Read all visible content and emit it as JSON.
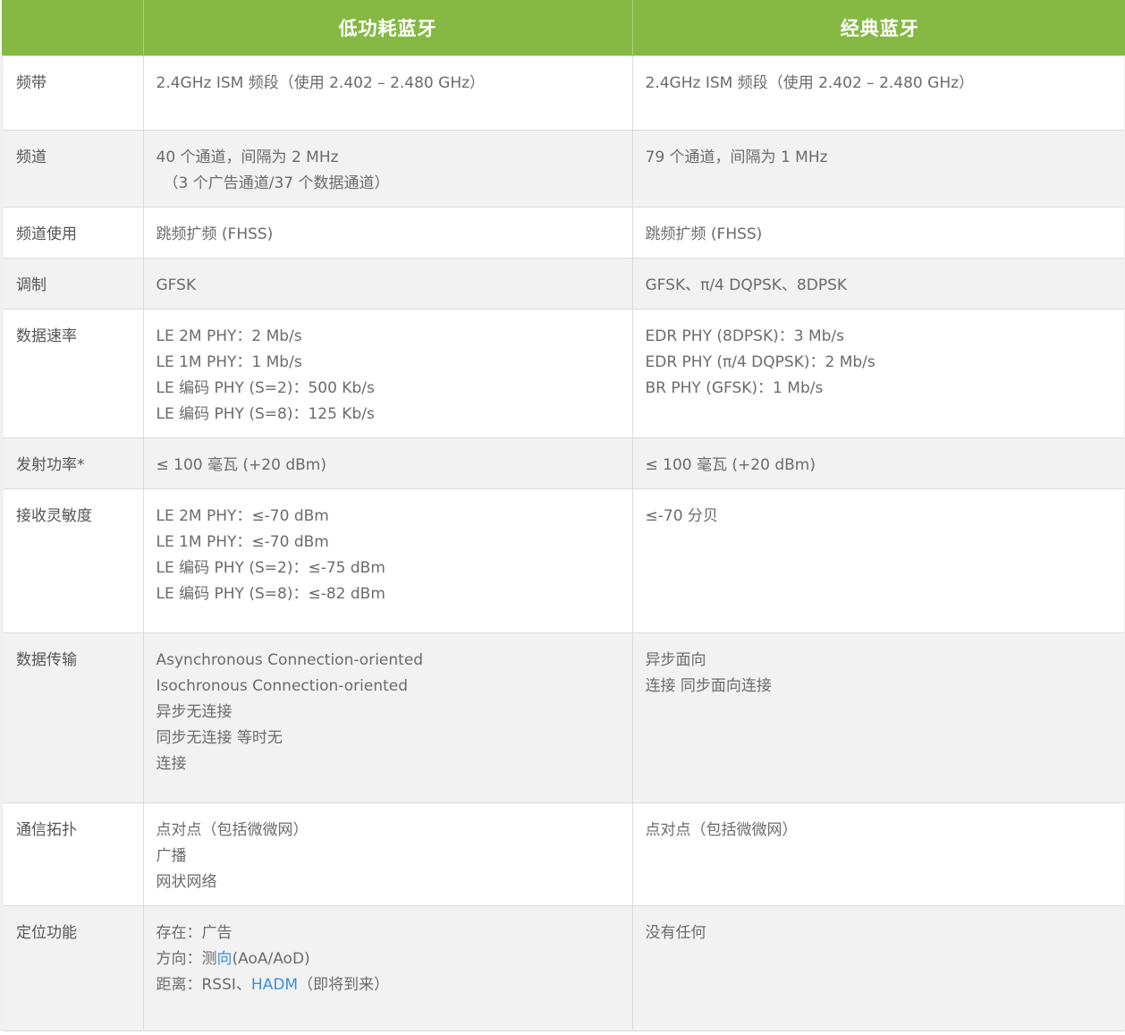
{
  "header": {
    "col1": "",
    "col2": "低功耗蓝牙",
    "col3": "经典蓝牙"
  },
  "colors": {
    "header_bg": "#85b944",
    "header_text": "#ffffff",
    "zebra": "#f2f2f2",
    "link": "#3b8fd6"
  },
  "rows": {
    "band": {
      "label": "频带",
      "le": [
        "2.4GHz ISM 频段（使用 2.402 – 2.480 GHz）"
      ],
      "classic": [
        "2.4GHz ISM 频段（使用 2.402 – 2.480 GHz）"
      ]
    },
    "channels": {
      "label": "频道",
      "le": [
        "40 个通道，间隔为 2 MHz",
        "（3 个广告通道/37 个数据通道）"
      ],
      "classic": [
        "79 个通道，间隔为 1 MHz"
      ]
    },
    "channel_usage": {
      "label": "频道使用",
      "le": [
        "跳频扩频 (FHSS)"
      ],
      "classic": [
        "跳频扩频 (FHSS)"
      ]
    },
    "modulation": {
      "label": "调制",
      "le": [
        "GFSK"
      ],
      "classic": [
        "GFSK、π/4 DQPSK、8DPSK"
      ]
    },
    "data_rate": {
      "label": "数据速率",
      "le": [
        "LE 2M PHY：2 Mb/s",
        "LE 1M PHY：1 Mb/s",
        "LE 编码 PHY (S=2)：500 Kb/s",
        "LE 编码 PHY (S=8)：125 Kb/s"
      ],
      "classic": [
        "EDR PHY (8DPSK)：3 Mb/s",
        "EDR PHY (π/4 DQPSK)：2 Mb/s",
        "BR PHY (GFSK)：1 Mb/s"
      ]
    },
    "tx_power": {
      "label": "发射功率*",
      "le": [
        "≤ 100 毫瓦 (+20 dBm)"
      ],
      "classic": [
        "≤ 100 毫瓦 (+20 dBm)"
      ]
    },
    "rx_sensitivity": {
      "label": "接收灵敏度",
      "le": [
        "LE 2M PHY：≤-70 dBm",
        "LE 1M PHY：≤-70 dBm",
        "LE 编码 PHY (S=2)：≤-75 dBm",
        "LE 编码 PHY (S=8)：≤-82 dBm"
      ],
      "classic": [
        "≤-70 分贝"
      ]
    },
    "data_transfer": {
      "label": "数据传输",
      "le": [
        "Asynchronous Connection-oriented",
        "Isochronous Connection-oriented",
        "异步无连接",
        "同步无连接 等时无",
        "连接"
      ],
      "classic": [
        "异步面向",
        "连接 同步面向连接"
      ]
    },
    "topology": {
      "label": "通信拓扑",
      "le": [
        "点对点（包括微微网）",
        "广播",
        "网状网络"
      ],
      "classic": [
        "点对点（包括微微网）"
      ]
    },
    "positioning": {
      "label": "定位功能",
      "le_presence": "存在：广告",
      "le_direction_prefix": "方向：测",
      "le_direction_link": "向",
      "le_direction_suffix": "(AoA/AoD)",
      "le_distance_prefix": "距离：RSSI、",
      "le_distance_link": "HADM",
      "le_distance_suffix": "（即将到来）",
      "classic": [
        "没有任何"
      ]
    }
  }
}
